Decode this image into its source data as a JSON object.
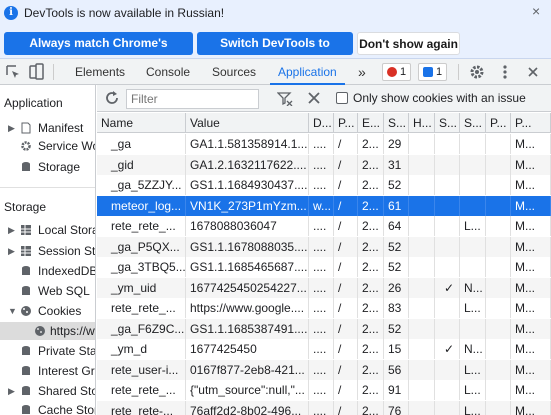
{
  "infobar": {
    "message": "DevTools is now available in Russian!",
    "buttons": {
      "match": "Always match Chrome's language",
      "switch": "Switch DevTools to Russian",
      "dismiss": "Don't show again"
    },
    "close_glyph": "×"
  },
  "toolbar": {
    "tabs": [
      "Elements",
      "Console",
      "Sources",
      "Application"
    ],
    "active_tab": "Application",
    "more_tabs_glyph": "»",
    "errors_count": "1",
    "messages_count": "1",
    "colors": {
      "accent": "#1a73e8",
      "error": "#d93025"
    }
  },
  "sidebar": {
    "application_heading": "Application",
    "application_items": [
      "Manifest",
      "Service Workers",
      "Storage"
    ],
    "storage_heading": "Storage",
    "storage_items": [
      "Local Storage",
      "Session Storage",
      "IndexedDB",
      "Web SQL",
      "Cookies",
      "https://www.google.com",
      "Private State Tokens",
      "Interest Groups",
      "Shared Storage",
      "Cache Storage"
    ]
  },
  "filter": {
    "placeholder": "Filter",
    "only_issues_label": "Only show cookies with an issue"
  },
  "cookies_table": {
    "columns": [
      "Name",
      "Value",
      "D...",
      "P...",
      "E...",
      "S...",
      "H...",
      "S...",
      "S...",
      "P...",
      "P..."
    ],
    "rows": [
      [
        "_ga",
        "GA1.1.581358914.1...",
        "....",
        "/",
        "2...",
        "29",
        "",
        "",
        "",
        "",
        "M..."
      ],
      [
        "_gid",
        "GA1.2.1632117622....",
        "....",
        "/",
        "2...",
        "31",
        "",
        "",
        "",
        "",
        "M..."
      ],
      [
        "_ga_5ZZJY...",
        "GS1.1.1684930437....",
        "....",
        "/",
        "2...",
        "52",
        "",
        "",
        "",
        "",
        "M..."
      ],
      [
        "meteor_log...",
        "VN1K_273P1mYzm...",
        "w...",
        "/",
        "2...",
        "61",
        "",
        "",
        "",
        "",
        "M..."
      ],
      [
        "rete_rete_...",
        "1678088036047",
        "....",
        "/",
        "2...",
        "64",
        "",
        "",
        "L...",
        "",
        "M..."
      ],
      [
        "_ga_P5QX...",
        "GS1.1.1678088035....",
        "....",
        "/",
        "2...",
        "52",
        "",
        "",
        "",
        "",
        "M..."
      ],
      [
        "_ga_3TBQ5...",
        "GS1.1.1685465687....",
        "....",
        "/",
        "2...",
        "52",
        "",
        "",
        "",
        "",
        "M..."
      ],
      [
        "_ym_uid",
        "1677425450254227...",
        "....",
        "/",
        "2...",
        "26",
        "",
        "✓",
        "N...",
        "",
        "M..."
      ],
      [
        "rete_rete_...",
        "https://www.google....",
        "....",
        "/",
        "2...",
        "83",
        "",
        "",
        "L...",
        "",
        "M..."
      ],
      [
        "_ga_F6Z9C...",
        "GS1.1.1685387491....",
        "....",
        "/",
        "2...",
        "52",
        "",
        "",
        "",
        "",
        "M..."
      ],
      [
        "_ym_d",
        "1677425450",
        "....",
        "/",
        "2...",
        "15",
        "",
        "✓",
        "N...",
        "",
        "M..."
      ],
      [
        "rete_user-i...",
        "0167f877-2eb8-421...",
        "....",
        "/",
        "2...",
        "56",
        "",
        "",
        "L...",
        "",
        "M..."
      ],
      [
        "rete_rete_...",
        "{\"utm_source\":null,\"...",
        "....",
        "/",
        "2...",
        "91",
        "",
        "",
        "L...",
        "",
        "M..."
      ],
      [
        "rete_rete-...",
        "76aff2d2-8b02-496...",
        "....",
        "/",
        "2...",
        "76",
        "",
        "",
        "L...",
        "",
        "M..."
      ]
    ],
    "selected_row": 3
  }
}
